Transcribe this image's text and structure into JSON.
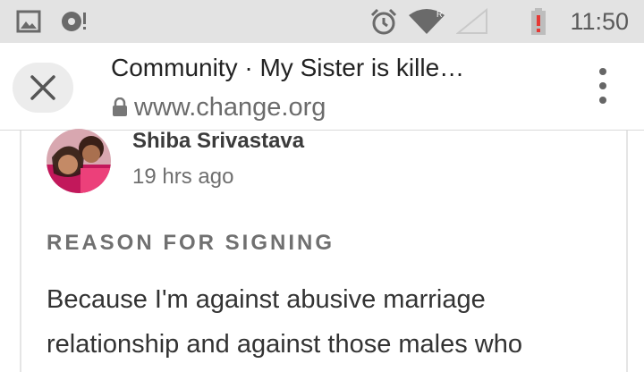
{
  "status_bar": {
    "time": "11:50",
    "icons": [
      "picture-icon",
      "music-sync-icon",
      "alarm-icon",
      "wifi-icon",
      "cell-signal-icon",
      "battery-alert-icon"
    ]
  },
  "toolbar": {
    "title": "Community · My Sister is kille…",
    "url": "www.change.org",
    "icons": [
      "close-icon",
      "lock-icon",
      "overflow-menu-icon"
    ]
  },
  "comment": {
    "author": "Shiba Srivastava",
    "time_ago": "19 hrs ago",
    "section_heading": "REASON FOR SIGNING",
    "text": "Because I'm against abusive marriage relationship and against those males who"
  },
  "colors": {
    "status_bar_bg": "#e3e3e3",
    "toolbar_bg": "#ffffff",
    "battery_alert": "#e53935"
  }
}
